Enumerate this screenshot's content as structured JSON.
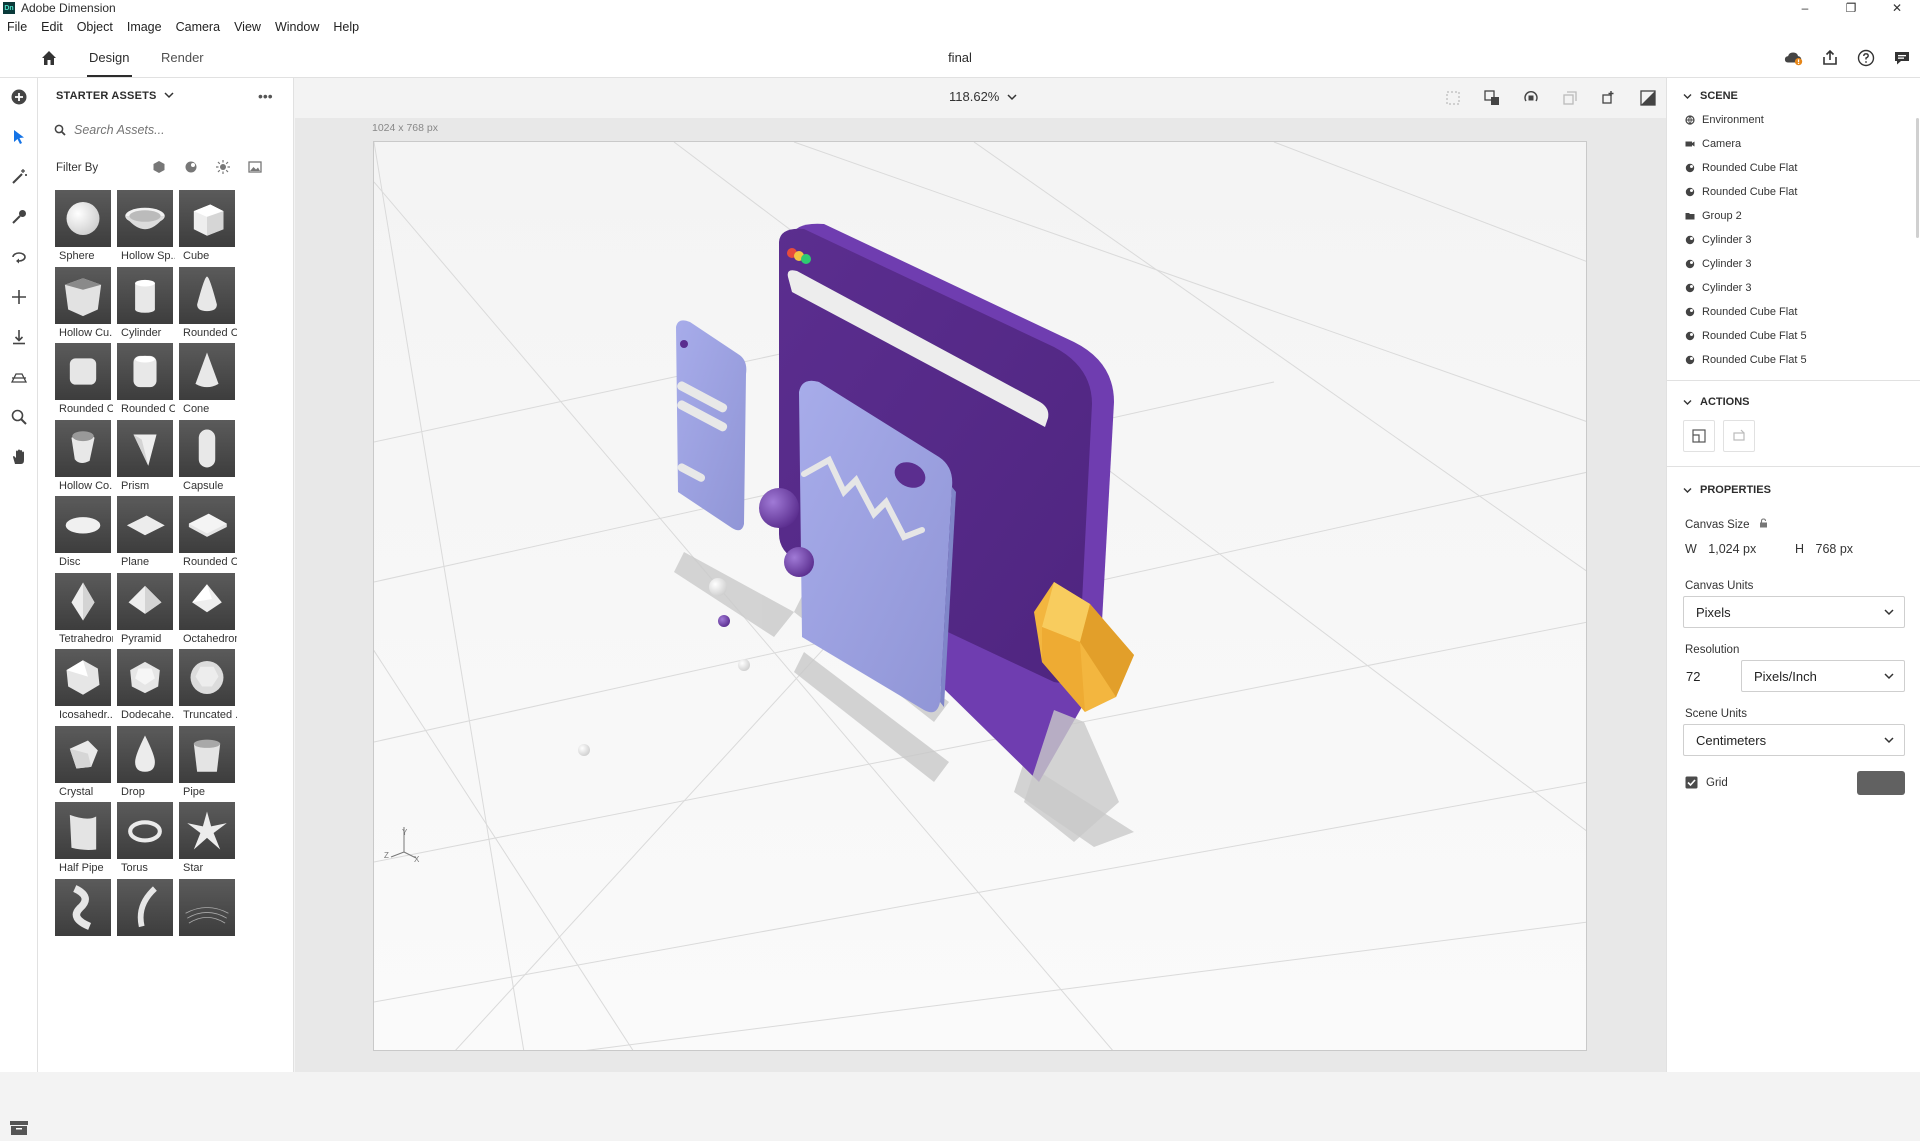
{
  "window": {
    "title": "Adobe Dimension",
    "badge": "Dn",
    "minimize": "–",
    "restore": "❐",
    "close": "✕"
  },
  "menu": [
    "File",
    "Edit",
    "Object",
    "Image",
    "Camera",
    "View",
    "Window",
    "Help"
  ],
  "topbar": {
    "tab_design": "Design",
    "tab_render": "Render",
    "doc_title": "final"
  },
  "assets": {
    "header": "STARTER ASSETS",
    "more": "•••",
    "search_placeholder": "Search Assets...",
    "filter_label": "Filter By",
    "items": [
      {
        "label": "Sphere",
        "shape": "sphere"
      },
      {
        "label": "Hollow Sp...",
        "shape": "bowl"
      },
      {
        "label": "Cube",
        "shape": "cube"
      },
      {
        "label": "Hollow Cu...",
        "shape": "hollow-cube"
      },
      {
        "label": "Cylinder",
        "shape": "cylinder"
      },
      {
        "label": "Rounded C...",
        "shape": "rounded-cone"
      },
      {
        "label": "Rounded C...",
        "shape": "rounded-cube"
      },
      {
        "label": "Rounded C...",
        "shape": "rounded-cylinder"
      },
      {
        "label": "Cone",
        "shape": "cone"
      },
      {
        "label": "Hollow Co...",
        "shape": "hollow-cone"
      },
      {
        "label": "Prism",
        "shape": "prism"
      },
      {
        "label": "Capsule",
        "shape": "capsule"
      },
      {
        "label": "Disc",
        "shape": "disc"
      },
      {
        "label": "Plane",
        "shape": "plane"
      },
      {
        "label": "Rounded C...",
        "shape": "rounded-plane"
      },
      {
        "label": "Tetrahedron",
        "shape": "tetrahedron"
      },
      {
        "label": "Pyramid",
        "shape": "pyramid"
      },
      {
        "label": "Octahedron",
        "shape": "octahedron"
      },
      {
        "label": "Icosahedr...",
        "shape": "icosahedron"
      },
      {
        "label": "Dodecahe...",
        "shape": "dodecahedron"
      },
      {
        "label": "Truncated ...",
        "shape": "truncated"
      },
      {
        "label": "Crystal",
        "shape": "crystal"
      },
      {
        "label": "Drop",
        "shape": "drop"
      },
      {
        "label": "Pipe",
        "shape": "pipe"
      },
      {
        "label": "Half Pipe",
        "shape": "half-pipe"
      },
      {
        "label": "Torus",
        "shape": "torus"
      },
      {
        "label": "Star",
        "shape": "star"
      },
      {
        "label": "",
        "shape": "twist"
      },
      {
        "label": "",
        "shape": "curve"
      },
      {
        "label": "",
        "shape": "fur"
      }
    ]
  },
  "viewport": {
    "zoom": "118.62%",
    "canvas_size": "1024 x 768 px",
    "axis_y": "Y",
    "axis_z": "Z",
    "axis_x": "X"
  },
  "scene": {
    "header": "SCENE",
    "items": [
      {
        "label": "Environment",
        "icon": "environment-icon"
      },
      {
        "label": "Camera",
        "icon": "camera-icon"
      },
      {
        "label": "Rounded Cube Flat",
        "icon": "model-icon"
      },
      {
        "label": "Rounded Cube Flat",
        "icon": "model-icon"
      },
      {
        "label": "Group 2",
        "icon": "folder-icon"
      },
      {
        "label": "Cylinder 3",
        "icon": "model-icon"
      },
      {
        "label": "Cylinder 3",
        "icon": "model-icon"
      },
      {
        "label": "Cylinder 3",
        "icon": "model-icon"
      },
      {
        "label": "Rounded Cube Flat",
        "icon": "model-icon"
      },
      {
        "label": "Rounded Cube Flat 5",
        "icon": "model-icon"
      },
      {
        "label": "Rounded Cube Flat 5",
        "icon": "model-icon"
      }
    ]
  },
  "actions": {
    "header": "ACTIONS"
  },
  "properties": {
    "header": "PROPERTIES",
    "canvas_size_label": "Canvas Size",
    "w_label": "W",
    "w_value": "1,024 px",
    "h_label": "H",
    "h_value": "768 px",
    "canvas_units_label": "Canvas Units",
    "canvas_units_value": "Pixels",
    "resolution_label": "Resolution",
    "resolution_value": "72",
    "resolution_unit": "Pixels/Inch",
    "scene_units_label": "Scene Units",
    "scene_units_value": "Centimeters",
    "grid_label": "Grid",
    "grid_checked": true,
    "grid_color": "#616161"
  },
  "colors": {
    "purple": "#5d2f91",
    "lavender": "#9da3de",
    "gold": "#f3b63f",
    "accent": "#1473e6"
  }
}
